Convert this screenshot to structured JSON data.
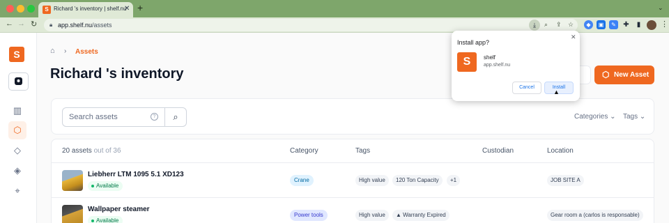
{
  "browser": {
    "tab_title": "Richard 's inventory | shelf.nu",
    "tab_favicon": "S",
    "url_host": "app.shelf.nu",
    "url_path": "/assets"
  },
  "sidebar": {
    "logo": "S",
    "items": [
      {
        "icon": "chart-icon",
        "active": false
      },
      {
        "icon": "cube-icon",
        "active": true
      },
      {
        "icon": "tag-icon",
        "active": false
      },
      {
        "icon": "tags-icon",
        "active": false
      },
      {
        "icon": "location-pin-icon",
        "active": false
      }
    ]
  },
  "breadcrumb": {
    "current": "Assets"
  },
  "page": {
    "title": "Richard 's inventory",
    "new_asset_label": "New Asset"
  },
  "filters": {
    "search_placeholder": "Search assets",
    "categories_label": "Categories",
    "tags_label": "Tags"
  },
  "table": {
    "count_text": "20 assets",
    "count_suffix": "out of 36",
    "headers": {
      "category": "Category",
      "tags": "Tags",
      "custodian": "Custodian",
      "location": "Location"
    },
    "rows": [
      {
        "name": "Liebherr LTM 1095 5.1 XD123",
        "status": "Available",
        "category": "Crane",
        "tags": [
          "High value",
          "120 Ton Capacity",
          "+1"
        ],
        "location": "JOB SITE A"
      },
      {
        "name": "Wallpaper steamer",
        "status": "Available",
        "category": "Power tools",
        "tags": [
          "High value",
          "▲ Warranty Expired"
        ],
        "location": "Gear room a (carlos is responsable)"
      }
    ]
  },
  "install_popup": {
    "title": "Install app?",
    "app_name": "shelf",
    "app_url": "app.shelf.nu",
    "cancel_label": "Cancel",
    "install_label": "Install"
  },
  "colors": {
    "brand": "#ef6820",
    "tabstrip": "#7ea66b",
    "toolbar": "#dfe9d6"
  }
}
